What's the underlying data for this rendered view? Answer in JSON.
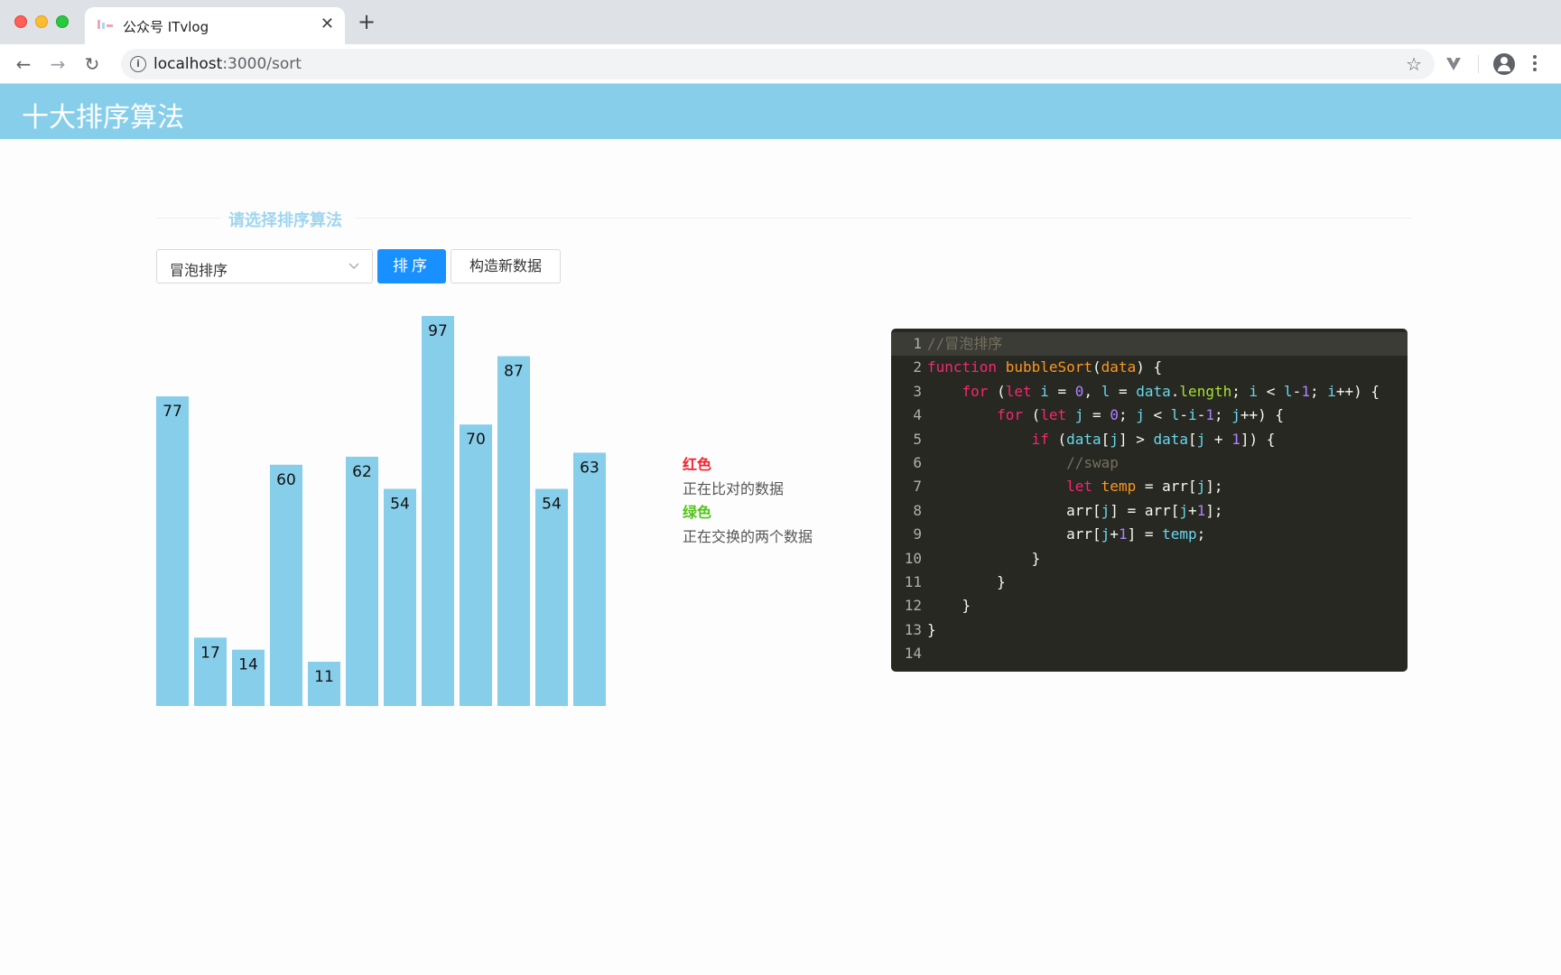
{
  "browser": {
    "tab_title": "公众号 ITvlog",
    "tab_close": "✕",
    "new_tab": "+",
    "url_host": "localhost",
    "url_path": ":3000/sort"
  },
  "header": {
    "title": "十大排序算法"
  },
  "controls": {
    "section_title": "请选择排序算法",
    "select_value": "冒泡排序",
    "sort_button": "排序",
    "new_data_button": "构造新数据"
  },
  "chart_data": {
    "type": "bar",
    "values": [
      77,
      17,
      14,
      60,
      11,
      62,
      54,
      97,
      70,
      87,
      54,
      63
    ],
    "ylim": [
      0,
      97
    ],
    "color": "#87ceeb"
  },
  "legend": {
    "red_label": "红色",
    "red_desc": "正在比对的数据",
    "green_label": "绿色",
    "green_desc": "正在交换的两个数据"
  },
  "code": {
    "line_numbers": [
      "1",
      "2",
      "3",
      "4",
      "5",
      "6",
      "7",
      "8",
      "9",
      "10",
      "11",
      "12",
      "13",
      "14"
    ]
  },
  "colors": {
    "header": "#87ceeb",
    "primary": "#1890ff",
    "editor_bg": "#272822"
  }
}
